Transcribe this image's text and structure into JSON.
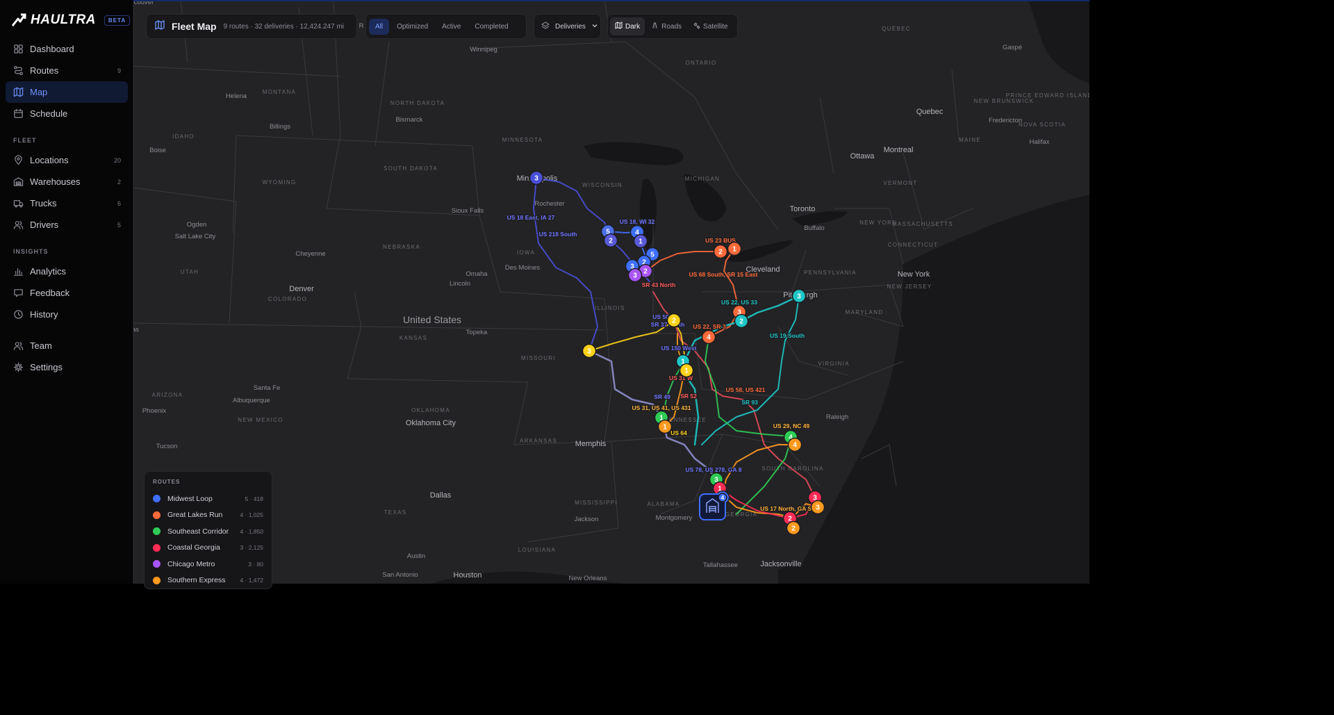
{
  "app": {
    "name": "HAULTRA",
    "badge": "BETA"
  },
  "nav": {
    "main": [
      {
        "label": "Dashboard",
        "icon": "dashboard-icon",
        "count": ""
      },
      {
        "label": "Routes",
        "icon": "routes-icon",
        "count": "9"
      },
      {
        "label": "Map",
        "icon": "map-icon",
        "count": "",
        "active": true
      },
      {
        "label": "Schedule",
        "icon": "calendar-icon",
        "count": ""
      }
    ],
    "fleet_title": "FLEET",
    "fleet": [
      {
        "label": "Locations",
        "icon": "pin-icon",
        "count": "20"
      },
      {
        "label": "Warehouses",
        "icon": "warehouse-icon",
        "count": "2"
      },
      {
        "label": "Trucks",
        "icon": "truck-icon",
        "count": "6"
      },
      {
        "label": "Drivers",
        "icon": "users-icon",
        "count": "5"
      }
    ],
    "insights_title": "INSIGHTS",
    "insights": [
      {
        "label": "Analytics",
        "icon": "bar-chart-icon",
        "count": ""
      },
      {
        "label": "Feedback",
        "icon": "message-icon",
        "count": ""
      },
      {
        "label": "History",
        "icon": "clock-icon",
        "count": ""
      }
    ],
    "bottom": [
      {
        "label": "Team",
        "icon": "team-icon",
        "count": ""
      },
      {
        "label": "Settings",
        "icon": "gear-icon",
        "count": ""
      }
    ]
  },
  "header": {
    "title": "Fleet Map",
    "subtitle": "9 routes · 32 deliveries · 12,424.247 mi",
    "filters": [
      "All",
      "Optimized",
      "Active",
      "Completed"
    ],
    "active_filter": "All",
    "layer_select": "Deliveries",
    "styles": [
      "Dark",
      "Roads",
      "Satellite"
    ],
    "active_style": "Dark"
  },
  "legend": {
    "title": "ROUTES",
    "items": [
      {
        "name": "Midwest Loop",
        "stats": "5 · 418",
        "color": "#3f6fff"
      },
      {
        "name": "Great Lakes Run",
        "stats": "4 · 1,025",
        "color": "#ff6a3a"
      },
      {
        "name": "Southeast Corridor",
        "stats": "4 · 1,850",
        "color": "#2fcc55"
      },
      {
        "name": "Coastal Georgia",
        "stats": "3 · 2,125",
        "color": "#ff2d55"
      },
      {
        "name": "Chicago Metro",
        "stats": "3 · 80",
        "color": "#a855f7"
      },
      {
        "name": "Southern Express",
        "stats": "4 · 1,472",
        "color": "#ff9a1f"
      }
    ]
  },
  "map_labels": {
    "countries": [
      "United States"
    ],
    "states": [
      "MONTANA",
      "NORTH DAKOTA",
      "MINNESOTA",
      "WISCONSIN",
      "MICHIGAN",
      "SOUTH DAKOTA",
      "WYOMING",
      "IDAHO",
      "NEBRASKA",
      "IOWA",
      "ILLINOIS",
      "UTAH",
      "COLORADO",
      "KANSAS",
      "MISSOURI",
      "ARIZONA",
      "NEW MEXICO",
      "OKLAHOMA",
      "ARKANSAS",
      "TEXAS",
      "MISSISSIPPI",
      "ALABAMA",
      "GEORGIA",
      "LOUISIANA",
      "SOUTH CAROLINA",
      "VIRGINIA",
      "MARYLAND",
      "PENNSYLVANIA",
      "NEW YORK",
      "VERMONT",
      "MAINE",
      "MASSACHUSETTS",
      "CONNECTICUT",
      "NEW JERSEY",
      "ONTARIO",
      "QUÉBEC",
      "NEW BRUNSWICK",
      "NOVA SCOTIA",
      "PRINCE EDWARD ISLAND",
      "ENNESSEE"
    ],
    "cities": [
      "couver",
      "Winnipeg",
      "Helena",
      "Billings",
      "Bismarck",
      "Boise",
      "Ogden",
      "Salt Lake City",
      "Cheyenne",
      "Denver",
      "Sioux Falls",
      "Rochester",
      "Minneapolis",
      "Omaha",
      "Lincoln",
      "Des Moines",
      "Topeka",
      "Santa Fe",
      "Albuquerque",
      "Phoenix",
      "Tucson",
      "Oklahoma City",
      "Memphis",
      "Dallas",
      "Austin",
      "San Antonio",
      "Houston",
      "New Orleans",
      "Jackson",
      "Montgomery",
      "Tallahassee",
      "Jacksonville",
      "Cleveland",
      "Toronto",
      "Buffalo",
      "New York",
      "Pittsburgh",
      "Raleigh",
      "Ottawa",
      "Montreal",
      "Quebec",
      "Fredericton",
      "Halifax",
      "Gaspé",
      "as",
      "R"
    ],
    "routes": [
      "US 18 East, IA 27",
      "US 218 South",
      "US 18, WI 32",
      "SR 43 North",
      "US 23 BUS",
      "US 68 South, SR 15 East",
      "US 22, US 33",
      "US 50",
      "SR 37 North",
      "US 22, SR 3",
      "US 150 West",
      "US 31 W",
      "US 19 South",
      "SR 52",
      "US 58, US 421",
      "SR 93",
      "SR 49",
      "US 31, US 41, US 431",
      "US 64",
      "US 29, NC 49",
      "US 78, US 278, GA 8",
      "US 17 North, GA Spur"
    ]
  }
}
